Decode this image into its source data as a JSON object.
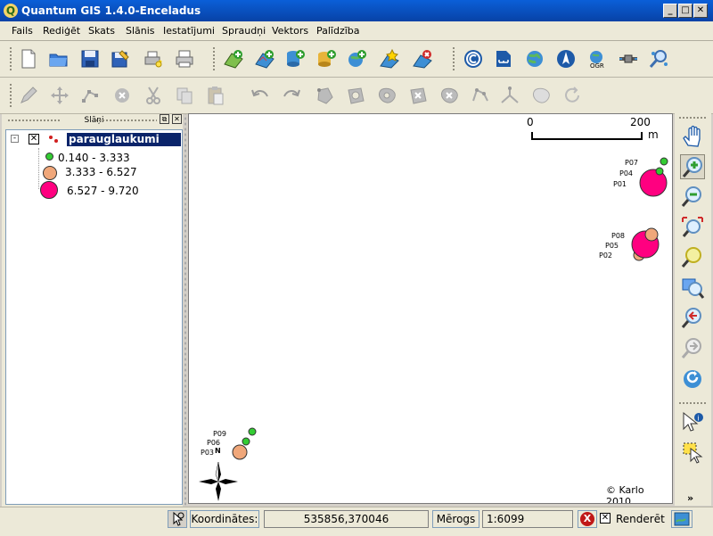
{
  "window": {
    "title": "Quantum GIS 1.4.0-Enceladus",
    "app_icon": "Q",
    "minimize_label": "_",
    "maximize_label": "□",
    "close_label": "✕"
  },
  "menu": [
    "Fails",
    "Rediģēt",
    "Skats",
    "Slānis",
    "Iestatījumi",
    "Spraudņi",
    "Vektors",
    "Palīdzība"
  ],
  "layers_panel": {
    "title": "Slāņi",
    "float_label": "⧉",
    "close_label": "✕",
    "layer_name": "parauglaukumi",
    "layer_visible": true,
    "classes": [
      {
        "label": "0.140 - 3.333",
        "color": "#33cc33"
      },
      {
        "label": "3.333 - 6.527",
        "color": "#f0a77a"
      },
      {
        "label": "6.527 - 9.720",
        "color": "#ff0080"
      }
    ]
  },
  "map": {
    "scalebar": {
      "start_label": "0",
      "end_label": "200",
      "unit": "m"
    },
    "points": [
      {
        "label": "P07"
      },
      {
        "label": "P04"
      },
      {
        "label": "P01"
      },
      {
        "label": "P08"
      },
      {
        "label": "P05"
      },
      {
        "label": "P02"
      },
      {
        "label": "P09"
      },
      {
        "label": "P06"
      },
      {
        "label": "P03"
      }
    ],
    "north_label": "N",
    "copyright": "© Karlo 2010"
  },
  "statusbar": {
    "coord_label": "Koordinātes:",
    "coord_value": "535856,370046",
    "scale_label": "Mērogs",
    "scale_value": "1:6099",
    "stop_label": "X",
    "render_label": "Renderēt",
    "render_checked": true
  },
  "icons": {
    "toolbar_file": [
      "new-project-icon",
      "open-project-icon",
      "save-project-icon",
      "save-as-icon",
      "print-composer-icon",
      "print-icon"
    ],
    "toolbar_layers": [
      "add-vector-layer-icon",
      "add-raster-layer-icon",
      "add-postgis-layer-icon",
      "add-spatialite-layer-icon",
      "add-wms-layer-icon",
      "new-vector-layer-icon",
      "remove-layer-icon"
    ],
    "toolbar_plugins": [
      "copyright-label-icon",
      "scalebar-icon",
      "world-map-icon",
      "north-arrow-icon",
      "ogr-converter-icon",
      "gps-tools-icon",
      "identify-plugin-icon"
    ],
    "toolbar_edit": [
      "toggle-editing-icon",
      "move-feature-icon",
      "node-tool-icon",
      "delete-selected-icon",
      "cut-features-icon",
      "copy-features-icon",
      "paste-features-icon",
      "undo-icon",
      "redo-icon",
      "simplify-feature-icon",
      "add-ring-icon",
      "add-island-icon",
      "delete-ring-icon",
      "delete-part-icon",
      "reshape-features-icon",
      "split-features-icon",
      "merge-features-icon",
      "rotate-label-icon"
    ],
    "map_nav": [
      "pan-icon",
      "zoom-in-icon",
      "zoom-out-icon",
      "zoom-full-icon",
      "zoom-to-layer-icon",
      "zoom-to-selection-icon",
      "zoom-last-icon",
      "zoom-next-icon",
      "refresh-icon",
      "identify-icon",
      "select-features-icon",
      "more-tools-icon"
    ]
  }
}
